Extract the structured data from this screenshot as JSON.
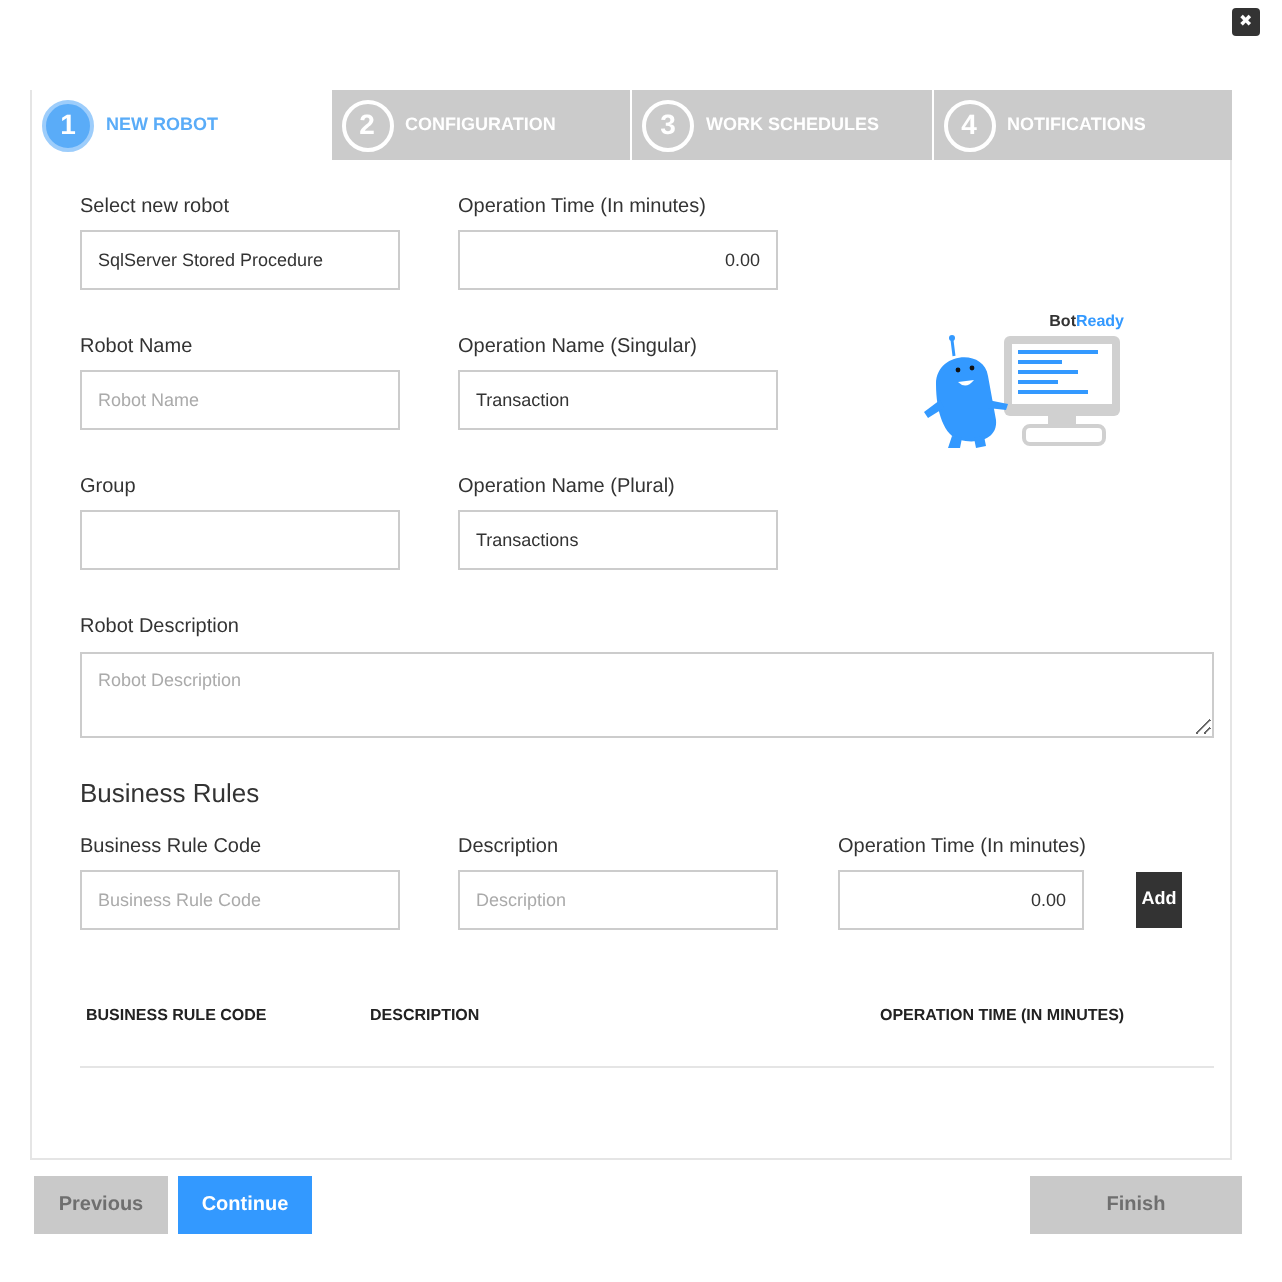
{
  "close_button": {
    "label": "✖"
  },
  "tabs": [
    {
      "number": "1",
      "label": "NEW ROBOT",
      "selected": true
    },
    {
      "number": "2",
      "label": "CONFIGURATION",
      "selected": false
    },
    {
      "number": "3",
      "label": "WORK SCHEDULES",
      "selected": false
    },
    {
      "number": "4",
      "label": "NOTIFICATIONS",
      "selected": false
    }
  ],
  "robot_fields": [
    [
      {
        "label": "Select new robot",
        "kind": "text",
        "value": "SqlServer Stored Procedure"
      },
      {
        "label": "Operation Time (In minutes)",
        "kind": "number",
        "value": "0.00"
      }
    ],
    [
      {
        "label": "Robot Name",
        "kind": "text",
        "placeholder": "Robot Name"
      },
      {
        "label": "Operation Name (Singular)",
        "kind": "text",
        "value": "Transaction"
      }
    ],
    [
      {
        "label": "Group",
        "kind": "text"
      },
      {
        "label": "Operation Name (Plural)",
        "kind": "text",
        "value": "Transactions"
      }
    ]
  ],
  "logo": {
    "dark_part": "Bot",
    "accent_part": "Ready"
  },
  "description": {
    "label": "Robot Description",
    "placeholder": "Robot Description"
  },
  "business_rules": {
    "heading": "Business Rules",
    "fields": [
      {
        "label": "Business Rule Code",
        "kind": "text",
        "placeholder": "Business Rule Code"
      },
      {
        "label": "Description",
        "kind": "text",
        "placeholder": "Description"
      },
      {
        "label": "Operation Time (In minutes)",
        "kind": "number",
        "value": "0.00"
      }
    ],
    "add_button": "Add",
    "table": {
      "columns": [
        "BUSINESS RULE CODE",
        "DESCRIPTION",
        "OPERATION TIME (IN MINUTES)"
      ]
    }
  },
  "buttons": [
    {
      "label": "Previous",
      "disabled": true
    },
    {
      "label": "Continue",
      "disabled": false
    }
  ],
  "finish_button": {
    "label": "Finish",
    "disabled": true
  }
}
